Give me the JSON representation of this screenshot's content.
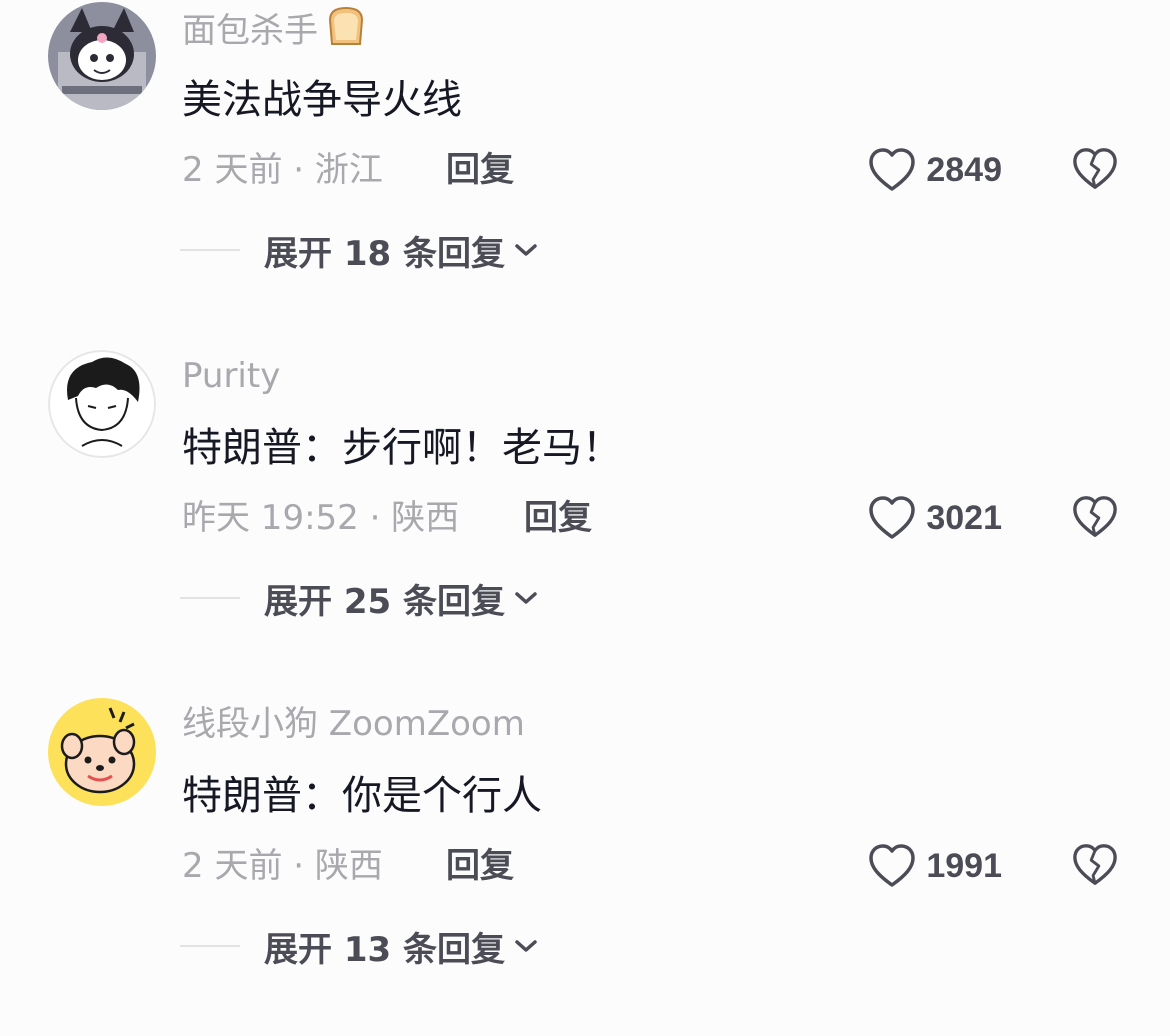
{
  "comments": [
    {
      "username": "面包杀手",
      "username_emoji": "bread-icon",
      "text": "美法战争导火线",
      "meta": "2 天前 · 浙江",
      "reply_label": "回复",
      "likes": "2849",
      "expand_label": "展开 18 条回复"
    },
    {
      "username": "Purity",
      "text": "特朗普：步行啊！老马！",
      "meta": "昨天 19:52 · 陕西",
      "reply_label": "回复",
      "likes": "3021",
      "expand_label": "展开 25 条回复"
    },
    {
      "username": "线段小狗 ZoomZoom",
      "text": "特朗普：你是个行人",
      "meta": "2 天前 · 陕西",
      "reply_label": "回复",
      "likes": "1991",
      "expand_label": "展开 13 条回复"
    }
  ],
  "colors": {
    "username": "#a8a8ad",
    "text": "#161823",
    "action": "#4b4c55",
    "divider": "#e3e3e6",
    "background": "#fcfcfc",
    "avatar3_bg": "#fde15a"
  }
}
